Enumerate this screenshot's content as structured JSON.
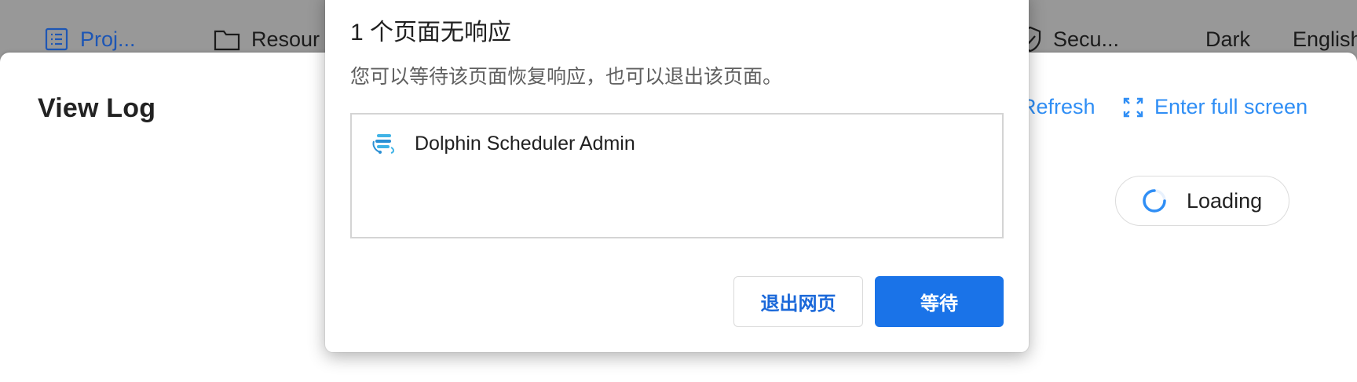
{
  "nav": {
    "projects_label": "Proj...",
    "resources_label": "Resour",
    "security_label": "Secu...",
    "theme_label": "Dark",
    "language_label": "English"
  },
  "panel": {
    "title": "View Log",
    "refresh_label": "Refresh",
    "fullscreen_label": "Enter full screen",
    "loading_label": "Loading"
  },
  "dialog": {
    "title": "1 个页面无响应",
    "message": "您可以等待该页面恢复响应，也可以退出该页面。",
    "pages": [
      {
        "name": "Dolphin Scheduler Admin"
      }
    ],
    "exit_button": "退出网页",
    "wait_button": "等待"
  },
  "colors": {
    "accent": "#1a73e8",
    "link": "#2f8ef5",
    "nav_active": "#1d56b5",
    "overlay": "#989898"
  },
  "icons": {
    "projects": "list-icon",
    "resources": "folder-icon",
    "security": "shield-icon",
    "fullscreen": "expand-icon",
    "loading": "spinner-icon",
    "page": "dolphin-scheduler-logo"
  }
}
